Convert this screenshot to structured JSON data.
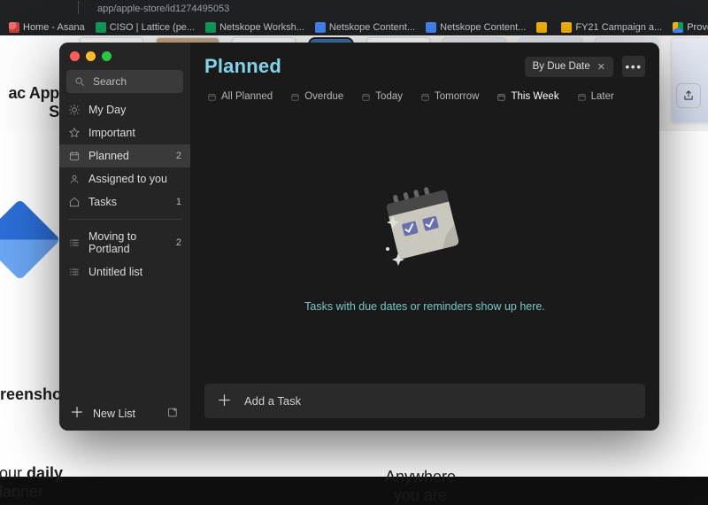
{
  "browser": {
    "url": "app/apple-store/id1274495053",
    "mac_header_right_icon_hint": "Share",
    "bookmarks": [
      {
        "label": "Home - Asana",
        "favicon": "asana"
      },
      {
        "label": "CISO | Lattice (pe...",
        "favicon": "green"
      },
      {
        "label": "Netskope Worksh...",
        "favicon": "green"
      },
      {
        "label": "Netskope Content...",
        "favicon": "blue"
      },
      {
        "label": "Netskope Content...",
        "favicon": "blue"
      },
      {
        "label": "",
        "favicon": "yellow"
      },
      {
        "label": "FY21 Campaign a...",
        "favicon": "folder"
      },
      {
        "label": "Prove It - Go",
        "favicon": "drive"
      }
    ],
    "background_text": {
      "mac_title": "ac App S",
      "reenshots": "reenshots",
      "daily_line1": "our ",
      "daily_word": "daily",
      "daily_line2": "lanner",
      "anywhere_line1": "Anywhere",
      "anywhere_line2": "you are"
    }
  },
  "sidebar": {
    "search_placeholder": "Search",
    "smart_lists": [
      {
        "icon": "sun",
        "label": "My Day",
        "count": null
      },
      {
        "icon": "star",
        "label": "Important",
        "count": null
      },
      {
        "icon": "calendar",
        "label": "Planned",
        "count": "2",
        "active": true
      },
      {
        "icon": "user",
        "label": "Assigned to you",
        "count": null
      },
      {
        "icon": "home",
        "label": "Tasks",
        "count": "1"
      }
    ],
    "user_lists": [
      {
        "icon": "list",
        "label": "Moving to Portland",
        "count": "2"
      },
      {
        "icon": "list",
        "label": "Untitled list",
        "count": null
      }
    ],
    "footer": {
      "new_list": "New List"
    }
  },
  "main": {
    "title": "Planned",
    "sort_label": "By Due Date",
    "filters": [
      {
        "label": "All Planned"
      },
      {
        "label": "Overdue"
      },
      {
        "label": "Today"
      },
      {
        "label": "Tomorrow"
      },
      {
        "label": "This Week",
        "active": true
      },
      {
        "label": "Later"
      }
    ],
    "empty_text": "Tasks with due dates or reminders show up here.",
    "add_task_label": "Add a Task"
  },
  "colors": {
    "accent": "#78c8c8",
    "header_title": "#83d4e9"
  }
}
